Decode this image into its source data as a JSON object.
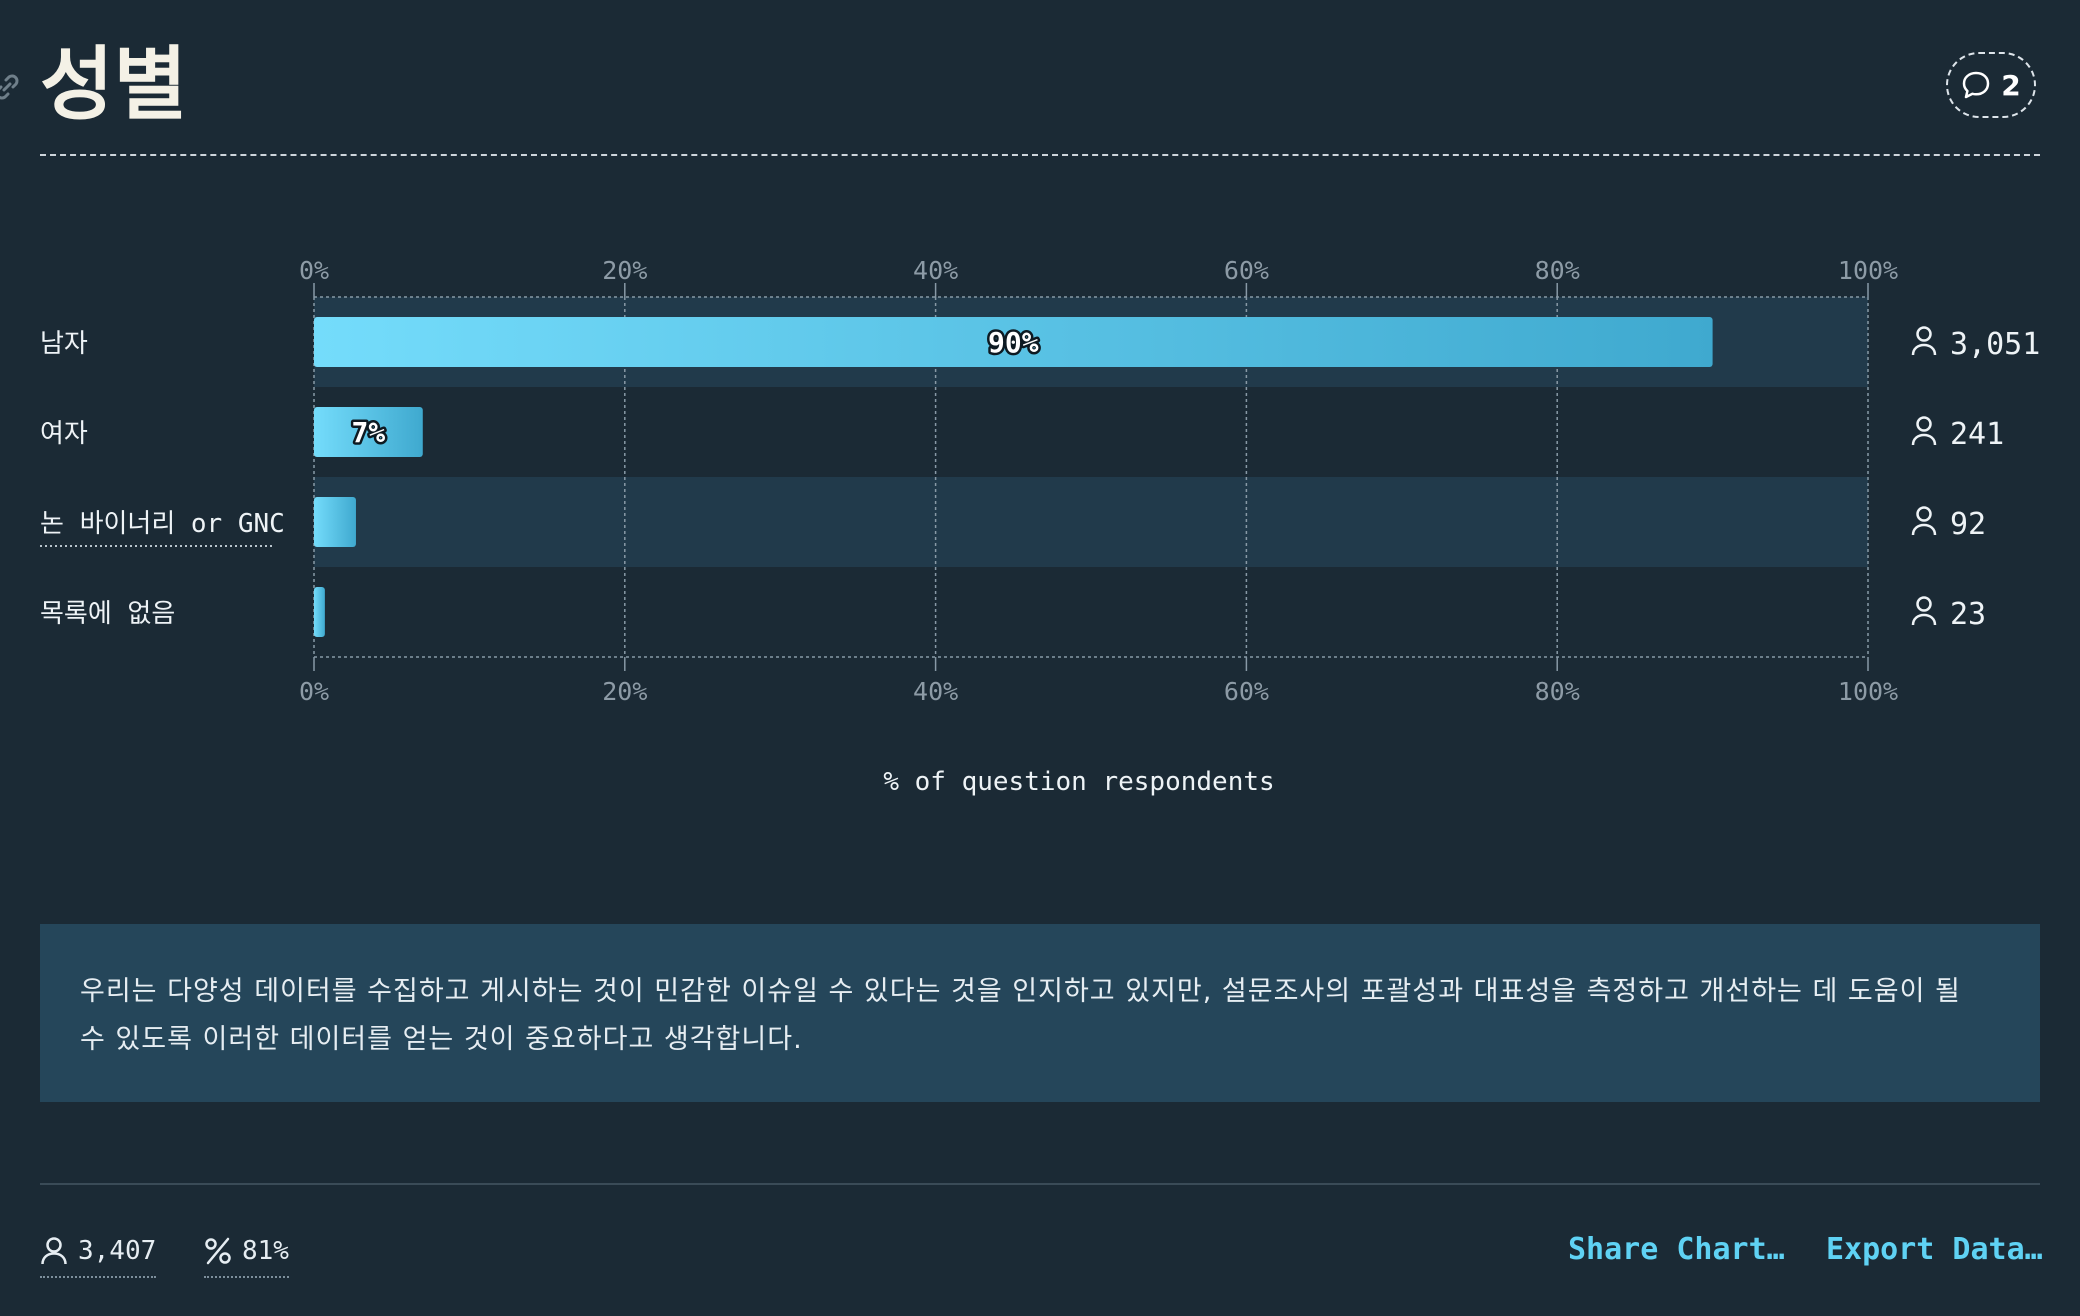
{
  "header": {
    "title": "성별",
    "comment_count": "2",
    "icons": {
      "link": "link-icon",
      "comment": "comment-bubble-icon"
    }
  },
  "chart_data": {
    "type": "bar",
    "orientation": "horizontal",
    "categories": [
      "남자",
      "여자",
      "논 바이너리 or GNC",
      "목록에 없음"
    ],
    "values": [
      90,
      7,
      2.7,
      0.7
    ],
    "value_labels": [
      "90%",
      "7%",
      "",
      ""
    ],
    "counts": [
      "3,051",
      "241",
      "92",
      "23"
    ],
    "xlim": [
      0,
      100
    ],
    "x_ticks": [
      "0%",
      "20%",
      "40%",
      "60%",
      "80%",
      "100%"
    ],
    "xlabel": "% of question respondents",
    "grid": true,
    "colors": {
      "bar_start": "#74dcfb",
      "bar_end": "#3fa9cf",
      "row_band": "#213a4b",
      "grid": "#8899a6"
    }
  },
  "note": {
    "text": "우리는 다양성 데이터를 수집하고 게시하는 것이 민감한 이슈일 수 있다는 것을 인지하고 있지만, 설문조사의 포괄성과 대표성을 측정하고 개선하는 데 도움이 될 수 있도록 이러한 데이터를 얻는 것이 중요하다고 생각합니다."
  },
  "footer": {
    "respondents": "3,407",
    "percent": "81%",
    "share_label": "Share Chart…",
    "export_label": "Export Data…"
  },
  "colors": {
    "background": "#1b2a35",
    "accent": "#5fd2f4",
    "title": "#f4f1e6",
    "note_bg": "#25465a"
  }
}
